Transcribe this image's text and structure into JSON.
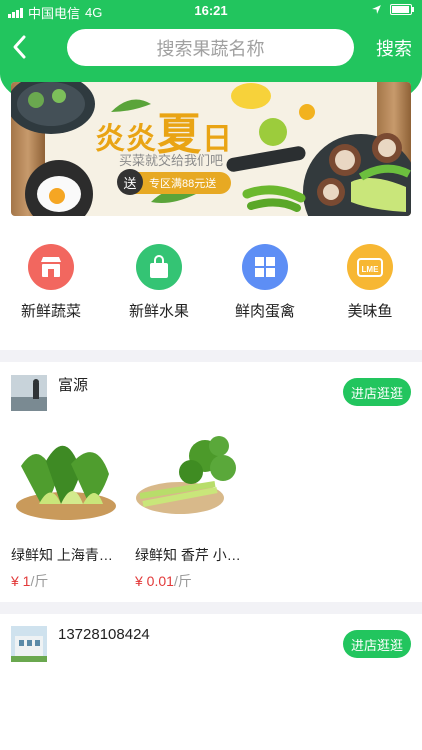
{
  "status_bar": {
    "carrier": "中国电信",
    "network": "4G",
    "time": "16:21"
  },
  "header": {
    "search_placeholder": "搜索果蔬名称",
    "search_button": "搜索"
  },
  "banner": {
    "title_prefix": "炎炎",
    "title_big": "夏",
    "title_suffix": "日",
    "subtitle": "买菜就交给我们吧",
    "send": "送",
    "tag": "专区满88元送"
  },
  "categories": [
    {
      "label": "新鲜蔬菜",
      "icon": "storefront-icon",
      "color": "#f2675f"
    },
    {
      "label": "新鲜水果",
      "icon": "shopping-bag-icon",
      "color": "#34c474"
    },
    {
      "label": "鲜肉蛋禽",
      "icon": "grid-icon",
      "color": "#5d8ef5"
    },
    {
      "label": "美味鱼",
      "icon": "lme-icon",
      "color": "#f7b733"
    }
  ],
  "stores": [
    {
      "name": "富源",
      "visit_label": "进店逛逛",
      "products": [
        {
          "name": "绿鲜知 上海青…",
          "price": "¥ 1",
          "unit": "/斤"
        },
        {
          "name": "绿鲜知 香芹 小…",
          "price": "¥ 0.01",
          "unit": "/斤"
        }
      ]
    },
    {
      "name": "13728108424",
      "visit_label": "进店逛逛"
    }
  ]
}
